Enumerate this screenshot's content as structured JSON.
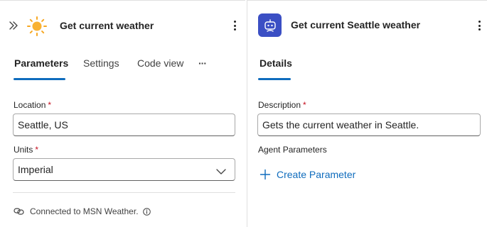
{
  "left_panel": {
    "title": "Get current weather",
    "tabs": [
      {
        "label": "Parameters",
        "active": true
      },
      {
        "label": "Settings",
        "active": false
      },
      {
        "label": "Code view",
        "active": false
      }
    ],
    "more_tabs_label": "···",
    "location": {
      "label": "Location",
      "required_mark": "*",
      "value": "Seattle, US"
    },
    "units": {
      "label": "Units",
      "required_mark": "*",
      "value": "Imperial"
    },
    "connection_text": "Connected to MSN Weather.",
    "icons": {
      "expand": "double-chevron-right-icon",
      "weather": "sun-icon",
      "menu": "more-vertical-icon",
      "connection": "link-icon",
      "info": "info-icon",
      "dropdown": "chevron-down-icon"
    }
  },
  "right_panel": {
    "title": "Get current Seattle weather",
    "tabs": [
      {
        "label": "Details",
        "active": true
      }
    ],
    "description": {
      "label": "Description",
      "required_mark": "*",
      "value": "Gets the current weather in Seattle."
    },
    "agent_parameters_label": "Agent Parameters",
    "create_parameter_label": "Create Parameter",
    "icons": {
      "agent": "bot-icon",
      "menu": "more-vertical-icon",
      "add": "plus-icon"
    }
  },
  "colors": {
    "accent": "#0f6cbd",
    "required": "#c50f1f",
    "agent_icon_bg": "#3b4fc4",
    "sun": "#f7a823"
  }
}
